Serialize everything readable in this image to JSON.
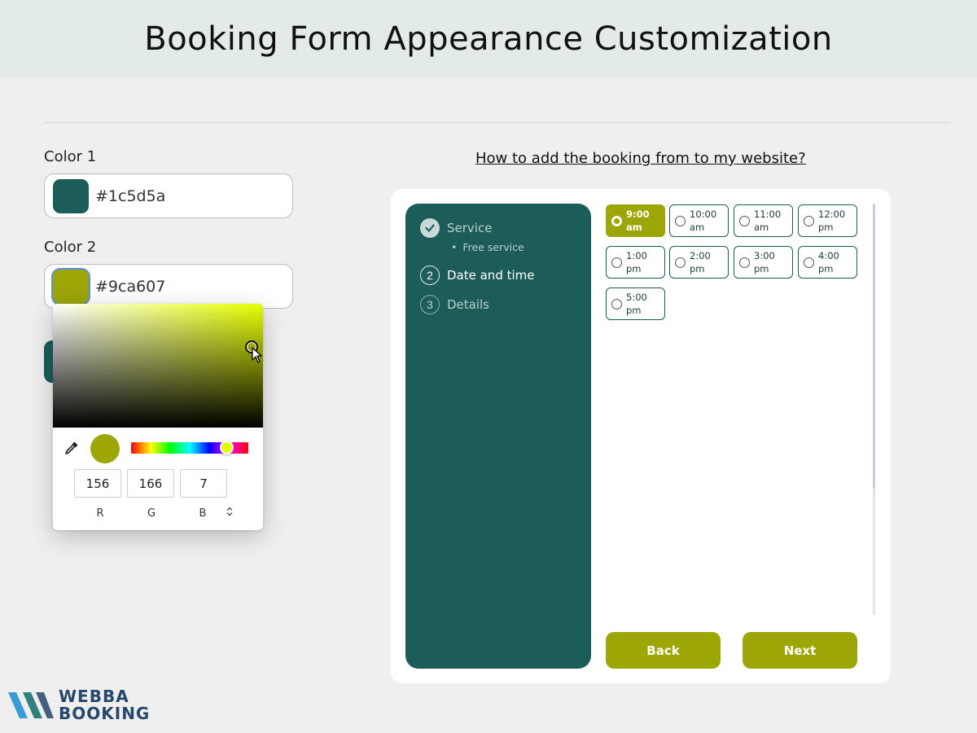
{
  "banner": {
    "title": "Booking Form Appearance Customization"
  },
  "colors": {
    "color1": {
      "label": "Color 1",
      "hex": "#1c5d5a",
      "swatch": "#1c5d5a"
    },
    "color2": {
      "label": "Color 2",
      "hex": "#9ca607",
      "swatch": "#9ca607"
    }
  },
  "picker": {
    "preview_color": "#9ca607",
    "r": "156",
    "g": "166",
    "b": "7",
    "r_label": "R",
    "g_label": "G",
    "b_label": "B"
  },
  "help_link": "How to add the booking from to my website?",
  "form": {
    "steps": [
      {
        "label": "Service",
        "number": "",
        "done": true
      },
      {
        "label": "Date and time",
        "number": "2",
        "done": false
      },
      {
        "label": "Details",
        "number": "3",
        "done": false
      }
    ],
    "service_sub": "Free service",
    "slots": [
      {
        "line1": "9:00 am",
        "line2": "",
        "selected": true
      },
      {
        "line1": "10:00",
        "line2": "am",
        "selected": false
      },
      {
        "line1": "11:00",
        "line2": "am",
        "selected": false
      },
      {
        "line1": "12:00",
        "line2": "pm",
        "selected": false
      },
      {
        "line1": "1:00 pm",
        "line2": "",
        "selected": false
      },
      {
        "line1": "2:00 pm",
        "line2": "",
        "selected": false
      },
      {
        "line1": "3:00 pm",
        "line2": "",
        "selected": false
      },
      {
        "line1": "4:00 pm",
        "line2": "",
        "selected": false
      },
      {
        "line1": "5:00 pm",
        "line2": "",
        "selected": false
      }
    ],
    "back_label": "Back",
    "next_label": "Next"
  },
  "logo": {
    "line1": "WEBBA",
    "line2": "BOOKING"
  },
  "theme": {
    "primary": "#1c5d5a",
    "accent": "#9ca607",
    "logo_dark": "#27476b",
    "logo_light": "#3a9bd5"
  }
}
